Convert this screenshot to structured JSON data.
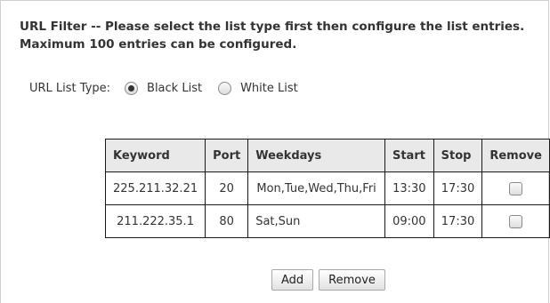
{
  "header": {
    "line1": "URL Filter -- Please select the list type first then configure the list entries.",
    "line2": "Maximum 100 entries can be configured."
  },
  "list_type": {
    "label": "URL List Type:",
    "options": [
      {
        "label": "Black List",
        "checked": true
      },
      {
        "label": "White List",
        "checked": false
      }
    ]
  },
  "table": {
    "headers": [
      "Keyword",
      "Port",
      "Weekdays",
      "Start",
      "Stop",
      "Remove"
    ],
    "rows": [
      {
        "keyword": "225.211.32.21",
        "port": "20",
        "weekdays": "Mon,Tue,Wed,Thu,Fri",
        "start": "13:30",
        "stop": "17:30"
      },
      {
        "keyword": "211.222.35.1",
        "port": "80",
        "weekdays": "Sat,Sun",
        "start": "09:00",
        "stop": "17:30"
      }
    ]
  },
  "buttons": {
    "add": "Add",
    "remove": "Remove"
  }
}
